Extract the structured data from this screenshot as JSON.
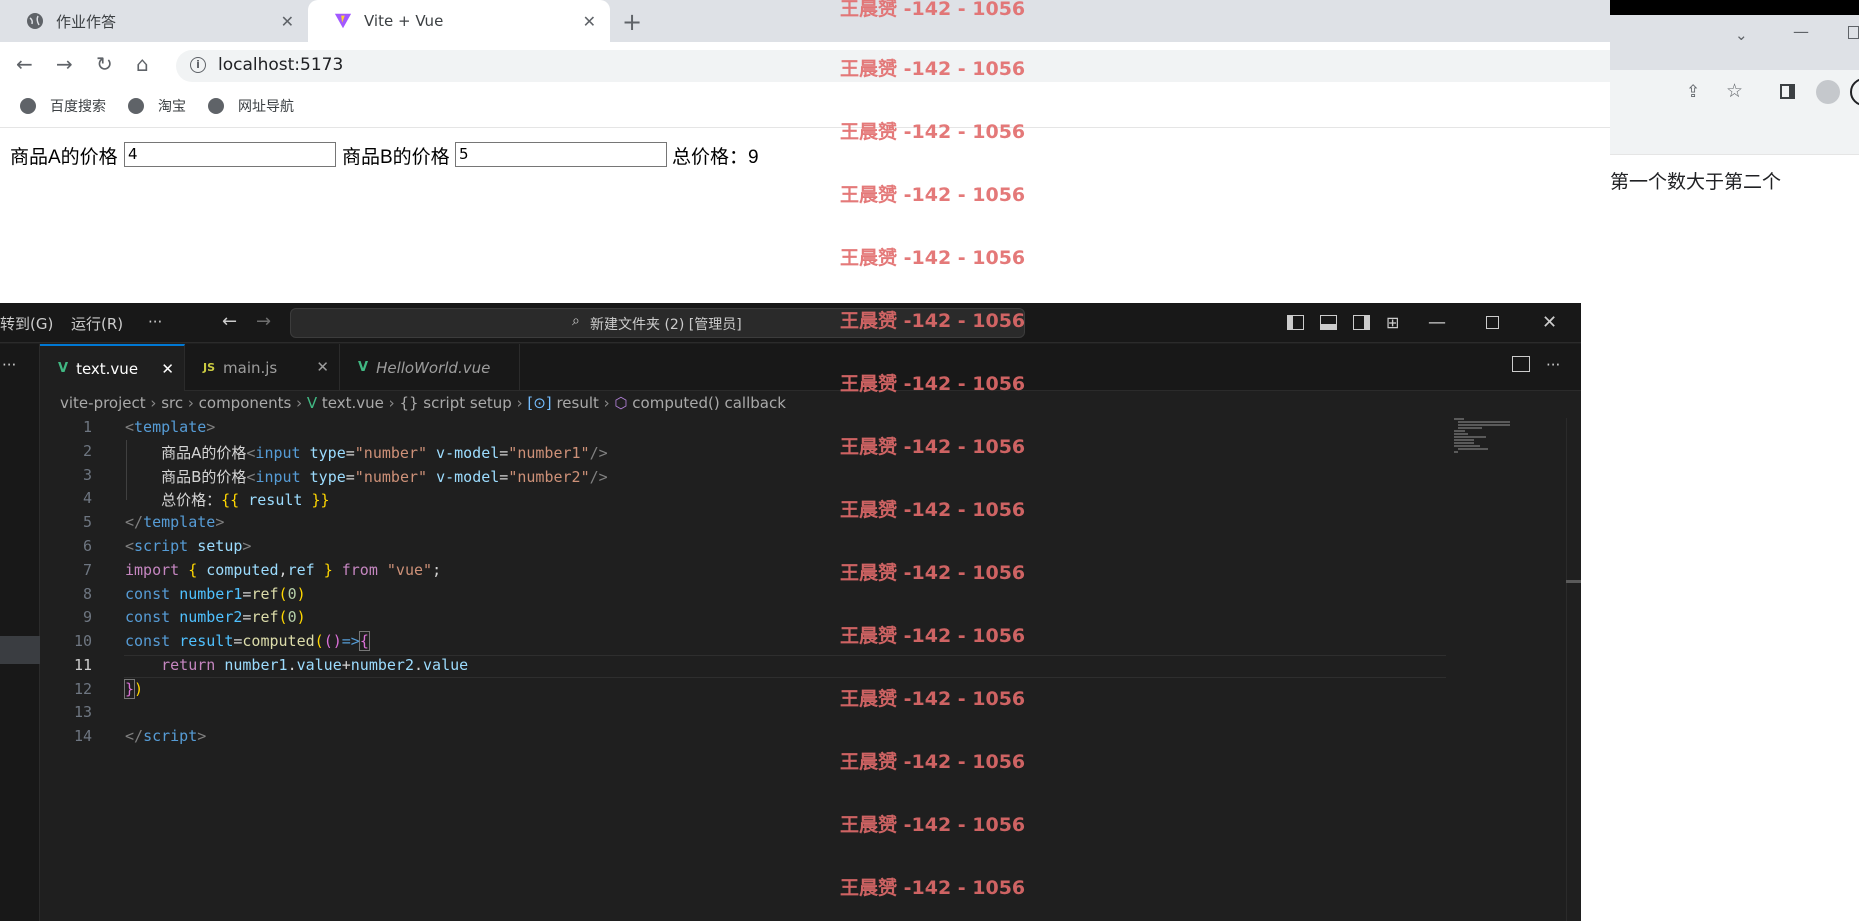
{
  "browser": {
    "tabs": [
      {
        "label": "作业作答",
        "icon": "globe-icon"
      },
      {
        "label": "Vite + Vue",
        "icon": "vite-logo-icon"
      }
    ],
    "url": "localhost:5173",
    "bookmarks": [
      "百度搜索",
      "淘宝",
      "网址导航"
    ],
    "page": {
      "label_a": "商品A的价格",
      "value_a": "4",
      "label_b": "商品B的价格",
      "value_b": "5",
      "total": "总价格：9"
    }
  },
  "right_browser": {
    "page_text": "第一个数大于第二个"
  },
  "vscode": {
    "menu": [
      "转到(G)",
      "运行(R)",
      "···"
    ],
    "command_center": "新建文件夹 (2) [管理员]",
    "tabs": [
      {
        "label": "text.vue",
        "icon": "V"
      },
      {
        "label": "main.js",
        "icon": "JS"
      },
      {
        "label": "HelloWorld.vue",
        "icon": "V"
      }
    ],
    "breadcrumb": {
      "p1": "vite-project",
      "p2": "src",
      "p3": "components",
      "p4": "text.vue",
      "p5": "{} script setup",
      "p6": "result",
      "p7": "computed() callback"
    },
    "line_numbers": [
      "1",
      "2",
      "3",
      "4",
      "5",
      "6",
      "7",
      "8",
      "9",
      "10",
      "11",
      "12",
      "13",
      "14"
    ],
    "active_line": "11",
    "code_text": {
      "l2_label": "商品A的价格",
      "l3_label": "商品B的价格",
      "l4_label": "总价格："
    }
  },
  "watermark": {
    "text": "王晨赟 -142 - 1056",
    "color": "#e26b6b"
  }
}
